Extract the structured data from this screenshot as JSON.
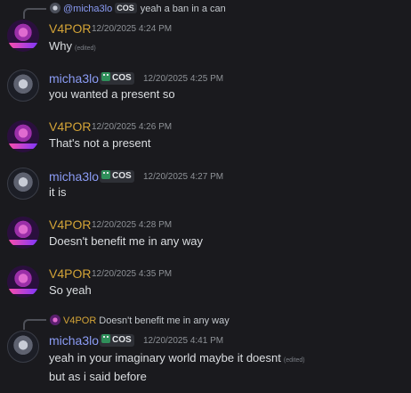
{
  "messages": [
    {
      "author": "V4POR",
      "time": "12/20/2025 4:24 PM",
      "reply": {
        "author": "@micha3lo",
        "tag": "COS",
        "text": "yeah a ban in a can"
      },
      "lines": [
        "Why"
      ],
      "edited_label": "(edited)"
    },
    {
      "author": "micha3lo",
      "tag": "COS",
      "time": "12/20/2025 4:25 PM",
      "lines": [
        "you wanted a present so"
      ]
    },
    {
      "author": "V4POR",
      "time": "12/20/2025 4:26 PM",
      "lines": [
        "That's not a present"
      ]
    },
    {
      "author": "micha3lo",
      "tag": "COS",
      "time": "12/20/2025 4:27 PM",
      "lines": [
        "it is"
      ]
    },
    {
      "author": "V4POR",
      "time": "12/20/2025 4:28 PM",
      "lines": [
        "Doesn't benefit me in any way"
      ]
    },
    {
      "author": "V4POR",
      "time": "12/20/2025 4:35 PM",
      "lines": [
        "So yeah"
      ]
    },
    {
      "author": "micha3lo",
      "tag": "COS",
      "time": "12/20/2025 4:41 PM",
      "reply": {
        "author": "V4POR",
        "text": "Doesn't benefit me in any way"
      },
      "lines": [
        "yeah in your imaginary world maybe it doesnt",
        "but as i said before"
      ],
      "edited_label": "(edited)"
    }
  ],
  "colors": {
    "background": "#1a1a1e",
    "v4por_name": "#d4a437",
    "micha_name": "#8b9cf5",
    "timestamp": "#8e9297"
  }
}
